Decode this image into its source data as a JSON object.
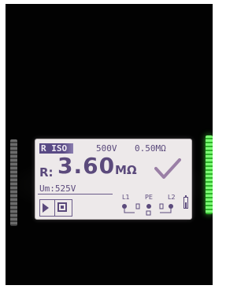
{
  "display": {
    "mode_label": "R ISO",
    "test_voltage": "500V",
    "limit_value": "0.50MΩ",
    "result_prefix": "R:",
    "result_value": "3.60",
    "result_unit": "MΩ",
    "measured_voltage": "Um:525V",
    "status": "pass-checkmark",
    "terminals": {
      "l1": "L1",
      "pe": "PE",
      "l2": "L2"
    },
    "icons": [
      "play-icon",
      "save-icon",
      "battery-icon",
      "checkmark-icon"
    ]
  },
  "colors": {
    "lcd_background": "#ede9ea",
    "lcd_ink": "#5b4a7c",
    "status_led": "#7cff74"
  }
}
